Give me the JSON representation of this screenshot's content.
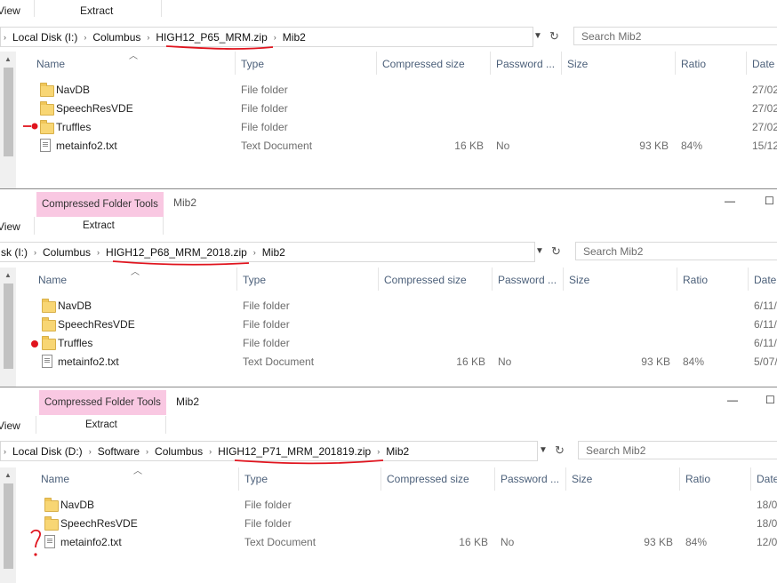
{
  "colors": {
    "context_tab": "#f9c8e2",
    "annotation": "#e0141e",
    "column_header": "#4c607a"
  },
  "windows": [
    {
      "ribbon": {
        "view_label": "View",
        "extract_label": "Extract"
      },
      "breadcrumb": [
        "Local Disk (I:)",
        "Columbus",
        "HIGH12_P65_MRM.zip",
        "Mib2"
      ],
      "search_placeholder": "Search Mib2",
      "columns": [
        "Name",
        "Type",
        "Compressed size",
        "Password ...",
        "Size",
        "Ratio",
        "Date"
      ],
      "rows": [
        {
          "name": "NavDB",
          "icon": "folder-icon",
          "type": "File folder",
          "compressed": "",
          "password": "",
          "size": "",
          "ratio": "",
          "date": "27/02"
        },
        {
          "name": "SpeechResVDE",
          "icon": "folder-icon",
          "type": "File folder",
          "compressed": "",
          "password": "",
          "size": "",
          "ratio": "",
          "date": "27/02"
        },
        {
          "name": "Truffles",
          "icon": "folder-icon",
          "type": "File folder",
          "compressed": "",
          "password": "",
          "size": "",
          "ratio": "",
          "date": "27/02"
        },
        {
          "name": "metainfo2.txt",
          "icon": "text-document-icon",
          "type": "Text Document",
          "compressed": "16 KB",
          "password": "No",
          "size": "93 KB",
          "ratio": "84%",
          "date": "15/12"
        }
      ]
    },
    {
      "ribbon": {
        "context_tab": "Compressed Folder Tools",
        "view_label": "View",
        "extract_label": "Extract",
        "title": "Mib2"
      },
      "breadcrumb": [
        "sk (I:)",
        "Columbus",
        "HIGH12_P68_MRM_2018.zip",
        "Mib2"
      ],
      "search_placeholder": "Search Mib2",
      "columns": [
        "Name",
        "Type",
        "Compressed size",
        "Password ...",
        "Size",
        "Ratio",
        "Date"
      ],
      "rows": [
        {
          "name": "NavDB",
          "icon": "folder-icon",
          "type": "File folder",
          "compressed": "",
          "password": "",
          "size": "",
          "ratio": "",
          "date": "6/11/"
        },
        {
          "name": "SpeechResVDE",
          "icon": "folder-icon",
          "type": "File folder",
          "compressed": "",
          "password": "",
          "size": "",
          "ratio": "",
          "date": "6/11/"
        },
        {
          "name": "Truffles",
          "icon": "folder-icon",
          "type": "File folder",
          "compressed": "",
          "password": "",
          "size": "",
          "ratio": "",
          "date": "6/11/"
        },
        {
          "name": "metainfo2.txt",
          "icon": "text-document-icon",
          "type": "Text Document",
          "compressed": "16 KB",
          "password": "No",
          "size": "93 KB",
          "ratio": "84%",
          "date": "5/07/"
        }
      ]
    },
    {
      "ribbon": {
        "context_tab": "Compressed Folder Tools",
        "view_label": "View",
        "extract_label": "Extract",
        "title": "Mib2"
      },
      "breadcrumb": [
        "Local Disk (D:)",
        "Software",
        "Columbus",
        "HIGH12_P71_MRM_201819.zip",
        "Mib2"
      ],
      "search_placeholder": "Search Mib2",
      "columns": [
        "Name",
        "Type",
        "Compressed size",
        "Password ...",
        "Size",
        "Ratio",
        "Date"
      ],
      "rows": [
        {
          "name": "NavDB",
          "icon": "folder-icon",
          "type": "File folder",
          "compressed": "",
          "password": "",
          "size": "",
          "ratio": "",
          "date": "18/0"
        },
        {
          "name": "SpeechResVDE",
          "icon": "folder-icon",
          "type": "File folder",
          "compressed": "",
          "password": "",
          "size": "",
          "ratio": "",
          "date": "18/0"
        },
        {
          "name": "metainfo2.txt",
          "icon": "text-document-icon",
          "type": "Text Document",
          "compressed": "16 KB",
          "password": "No",
          "size": "93 KB",
          "ratio": "84%",
          "date": "12/0"
        }
      ]
    }
  ]
}
